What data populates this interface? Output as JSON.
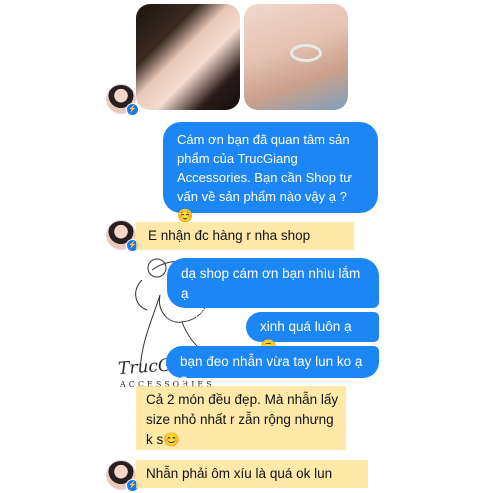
{
  "photos": {
    "left": "selfie photo",
    "right": "ring on hand photo"
  },
  "watermark": {
    "brand": "TrucGiang",
    "sub": "ACCESSORIES"
  },
  "messages": [
    {
      "dir": "out",
      "text": "Cám ơn bạn đã quan tâm sản phẩm của TrucGiang Accessories. Bạn cần Shop tư vấn về sản phẩm nào vậy ạ ? ☺️"
    },
    {
      "dir": "in",
      "text": "E nhận đc hàng r nha shop"
    },
    {
      "dir": "out",
      "text": "dạ shop cám ơn bạn nhìu lắm ạ"
    },
    {
      "dir": "out",
      "text": "😍😍😍"
    },
    {
      "dir": "out",
      "text": "xinh quá luôn ạ 🙃"
    },
    {
      "dir": "out",
      "text": "bạn đeo nhẫn vừa tay lun ko ạ ?"
    },
    {
      "dir": "in",
      "text": "Cả 2 món đều đẹp. Mà nhẫn lấy size nhỏ nhất r zẫn rộng nhưng k s😊"
    },
    {
      "dir": "in",
      "text": "Nhẫn phải ôm xíu là quá ok lun"
    }
  ],
  "colors": {
    "outgoing": "#1d86f5",
    "incoming": "#efefef",
    "highlight": "#ffe28c"
  }
}
